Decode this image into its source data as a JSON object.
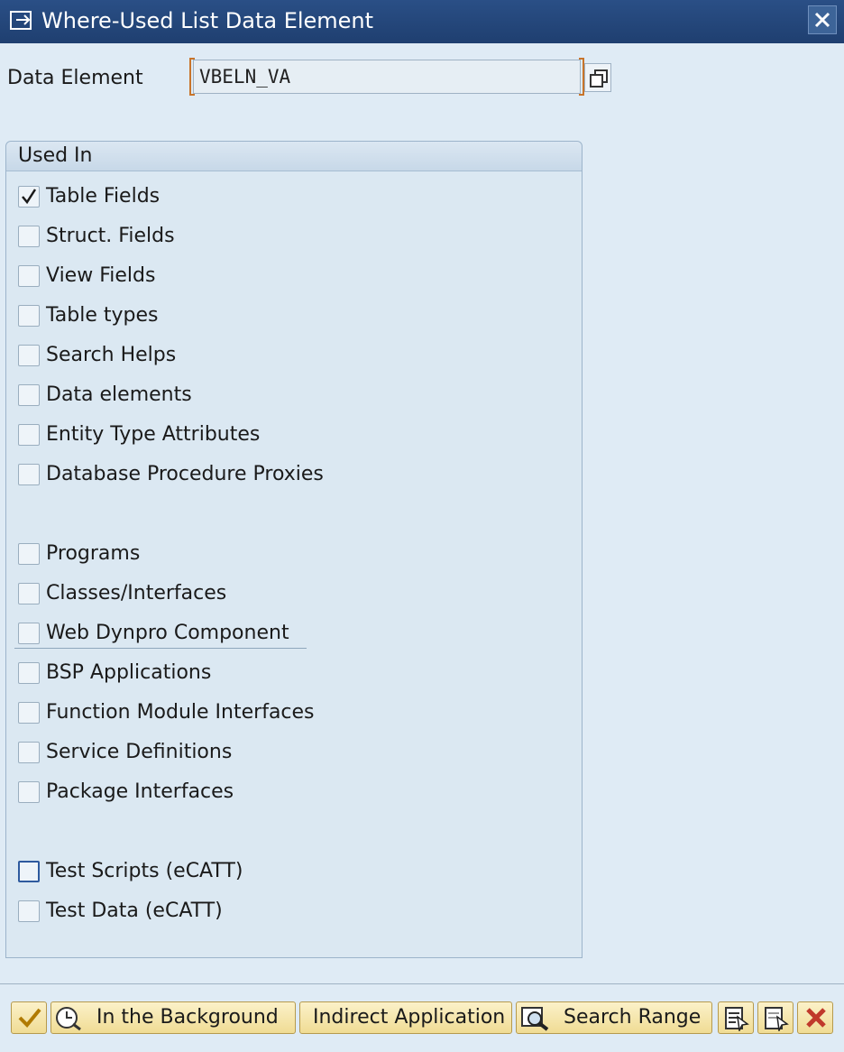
{
  "window": {
    "title": "Where-Used List Data Element",
    "title_icon": "popup-window-icon",
    "close_icon": "close-icon"
  },
  "field": {
    "label": "Data Element",
    "value": "VBELN_VA",
    "help_icon": "copy-window-icon"
  },
  "group": {
    "title": "Used In",
    "checkboxes": [
      {
        "label": "Table Fields",
        "checked": true
      },
      {
        "label": "Struct. Fields",
        "checked": false
      },
      {
        "label": "View Fields",
        "checked": false
      },
      {
        "label": "Table types",
        "checked": false
      },
      {
        "label": "Search Helps",
        "checked": false
      },
      {
        "label": "Data elements",
        "checked": false
      },
      {
        "label": "Entity Type Attributes",
        "checked": false
      },
      {
        "label": "Database Procedure Proxies",
        "checked": false
      },
      {
        "label": "Programs",
        "checked": false
      },
      {
        "label": "Classes/Interfaces",
        "checked": false
      },
      {
        "label": "Web Dynpro Component",
        "checked": false
      },
      {
        "label": "BSP Applications",
        "checked": false
      },
      {
        "label": "Function Module Interfaces",
        "checked": false
      },
      {
        "label": "Service Definitions",
        "checked": false
      },
      {
        "label": "Package Interfaces",
        "checked": false
      },
      {
        "label": "Test Scripts (eCATT)",
        "checked": false,
        "focused": true
      },
      {
        "label": "Test Data (eCATT)",
        "checked": false
      }
    ]
  },
  "toolbar": {
    "execute_icon": "checkmark-icon",
    "background_label": "In the Background",
    "background_icon": "clock-icon",
    "indirect_label": "Indirect Application",
    "search_range_label": "Search Range",
    "search_range_icon": "magnifier-icon",
    "select_all_icon": "select-all-icon",
    "deselect_all_icon": "deselect-all-icon",
    "cancel_icon": "cancel-icon"
  },
  "colors": {
    "title_bar": "#1f3f70",
    "background": "#dfebf5",
    "button_face": "#f0dc94",
    "focus_border": "#2e5a9e",
    "cancel_red": "#c0392b"
  }
}
